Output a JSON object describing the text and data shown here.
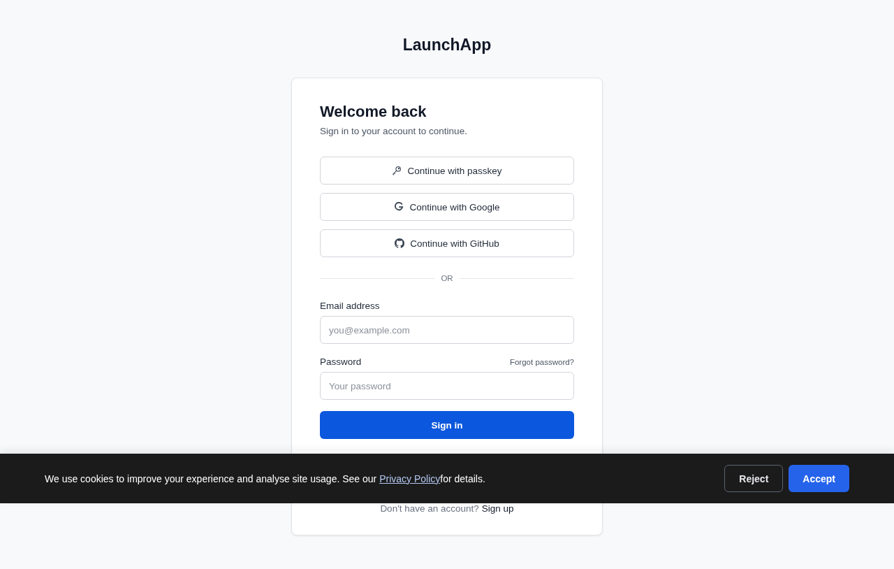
{
  "brand": "LaunchApp",
  "card": {
    "title": "Welcome back",
    "subtitle": "Sign in to your account to continue.",
    "providers": [
      {
        "kind": "passkey",
        "label": "Continue with passkey"
      },
      {
        "kind": "google",
        "label": "Continue with Google"
      },
      {
        "kind": "github",
        "label": "Continue with GitHub"
      }
    ],
    "divider": "OR",
    "email": {
      "label": "Email address",
      "placeholder": "you@example.com"
    },
    "password": {
      "label": "Password",
      "placeholder": "Your password",
      "forgot": "Forgot password?"
    },
    "submit": "Sign in",
    "footer": {
      "text": "Don't have an account?",
      "link": "Sign up"
    }
  },
  "cookie_banner": {
    "text_before": "We use cookies to improve your experience and analyse site usage. See our",
    "link": "Privacy Policy",
    "text_after": "for details.",
    "reject": "Reject",
    "accept": "Accept"
  }
}
